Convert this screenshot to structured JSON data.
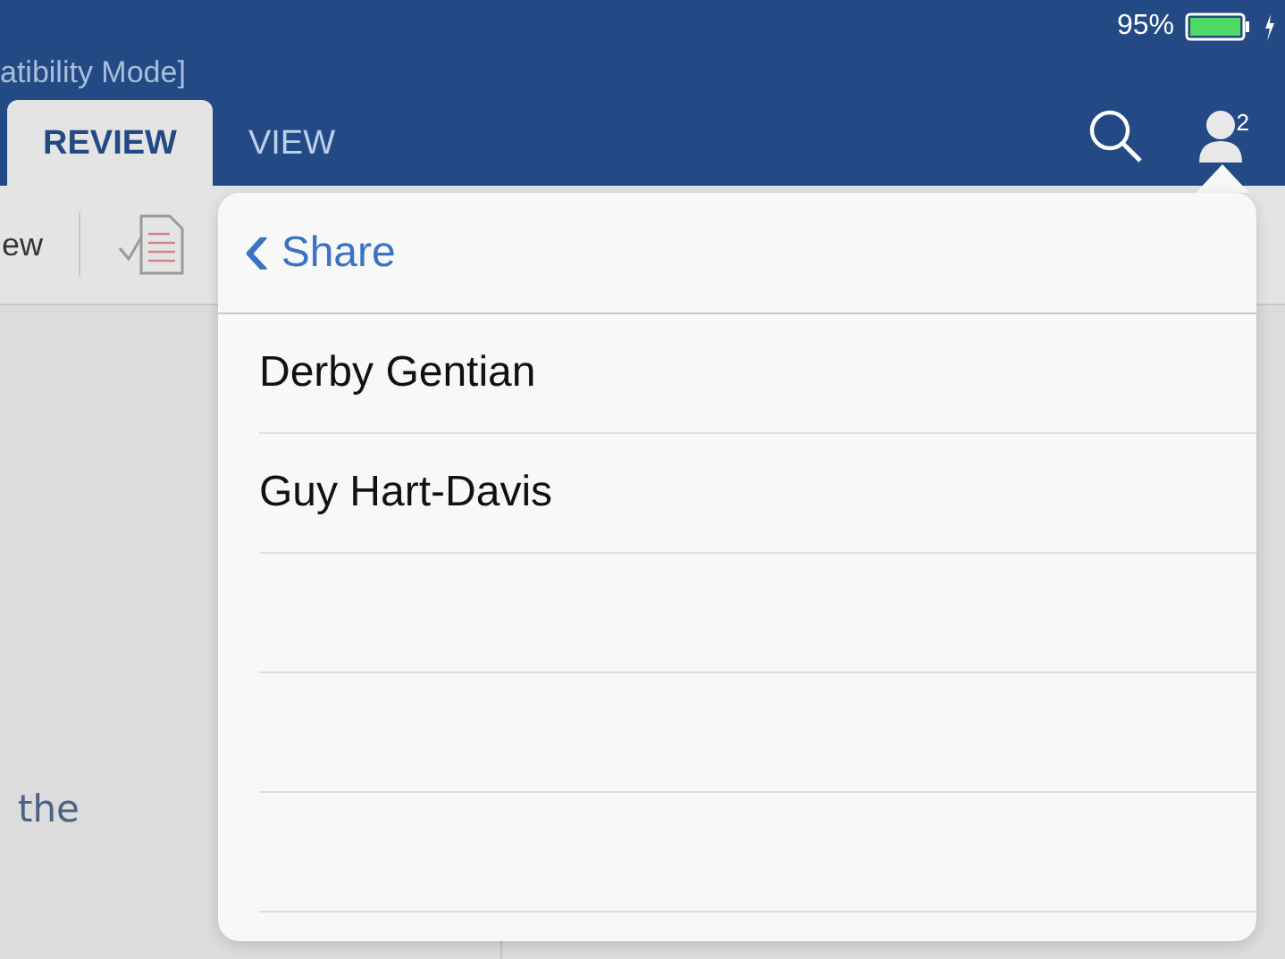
{
  "status_bar": {
    "battery": "95%",
    "charging": true
  },
  "window": {
    "title": "atibility Mode]"
  },
  "tabs": [
    {
      "label": "REVIEW",
      "selected": true
    },
    {
      "label": "VIEW",
      "selected": false
    }
  ],
  "toolbar": {
    "partial_label": "ew"
  },
  "account": {
    "badge": "2"
  },
  "document": {
    "text": "the"
  },
  "share_popover": {
    "back": "‹",
    "title": "Share",
    "people": [
      "Derby Gentian",
      "Guy Hart-Davis"
    ]
  }
}
